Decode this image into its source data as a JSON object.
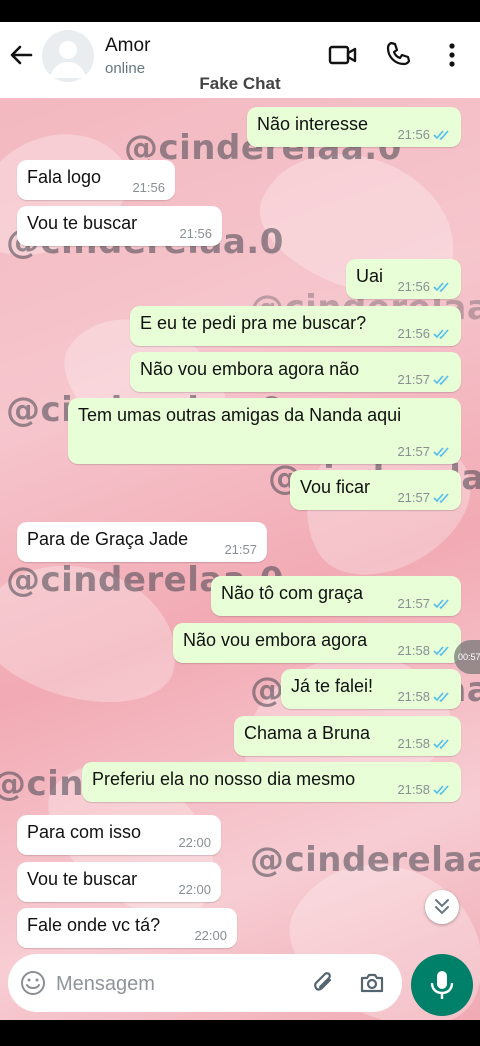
{
  "header": {
    "contact_name": "Amor",
    "status": "online",
    "overlay_title": "Fake Chat"
  },
  "watermark_text": "@cinderelaa.0",
  "messages": [
    {
      "dir": "out",
      "text": "Não interesse",
      "time": "21:56",
      "read": true
    },
    {
      "dir": "in",
      "text": "Fala logo",
      "time": "21:56"
    },
    {
      "dir": "in",
      "text": "Vou te buscar",
      "time": "21:56"
    },
    {
      "dir": "out",
      "text": "Uai",
      "time": "21:56",
      "read": true
    },
    {
      "dir": "out",
      "text": "E eu te pedi pra me buscar?",
      "time": "21:56",
      "read": true
    },
    {
      "dir": "out",
      "text": "Não vou embora agora não",
      "time": "21:57",
      "read": true
    },
    {
      "dir": "out",
      "text": "Tem umas outras amigas da Nanda aqui",
      "time": "21:57",
      "read": true
    },
    {
      "dir": "out",
      "text": "Vou ficar",
      "time": "21:57",
      "read": true
    },
    {
      "dir": "in",
      "text": "Para de Graça Jade",
      "time": "21:57"
    },
    {
      "dir": "out",
      "text": "Não tô com graça",
      "time": "21:57",
      "read": true
    },
    {
      "dir": "out",
      "text": "Não vou embora agora",
      "time": "21:58",
      "read": true
    },
    {
      "dir": "out",
      "text": "Já te falei!",
      "time": "21:58",
      "read": true
    },
    {
      "dir": "out",
      "text": "Chama a Bruna",
      "time": "21:58",
      "read": true
    },
    {
      "dir": "out",
      "text": "Preferiu ela no nosso dia mesmo",
      "time": "21:58",
      "read": true
    },
    {
      "dir": "in",
      "text": "Para com isso",
      "time": "22:00"
    },
    {
      "dir": "in",
      "text": "Vou te buscar",
      "time": "22:00"
    },
    {
      "dir": "in",
      "text": "Fale onde vc tá?",
      "time": "22:00"
    }
  ],
  "side_timer": "00:57",
  "composer": {
    "placeholder": "Mensagem"
  },
  "icons": {
    "back": "arrow-left-icon",
    "video": "video-camera-icon",
    "call": "phone-icon",
    "more": "more-vertical-icon",
    "emoji": "emoji-icon",
    "attach": "paperclip-icon",
    "camera": "camera-icon",
    "mic": "microphone-icon",
    "jump": "chevron-double-down-icon"
  },
  "colors": {
    "outgoing_bubble": "#e7fed6",
    "incoming_bubble": "#ffffff",
    "read_ticks": "#53bdeb",
    "mic_button": "#008069"
  }
}
